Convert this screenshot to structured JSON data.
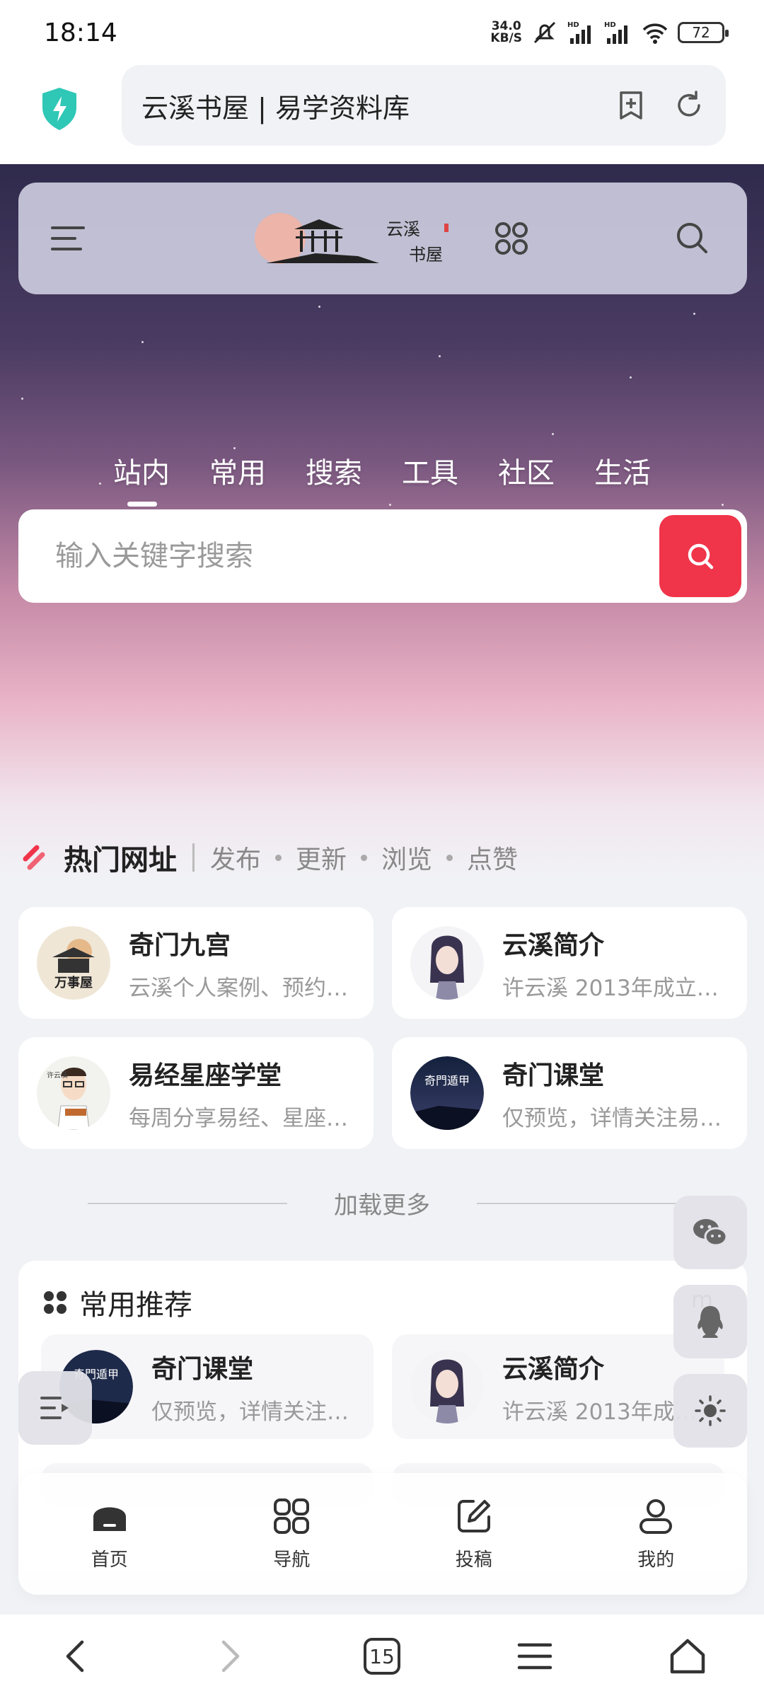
{
  "status_bar": {
    "time": "18:14",
    "net_speed_value": "34.0",
    "net_speed_unit": "KB/S",
    "battery": "72",
    "icons": [
      "mute-icon",
      "signal-hd-icon",
      "signal-hd-icon",
      "wifi-icon",
      "battery-icon"
    ]
  },
  "browser": {
    "url_title": "云溪书屋 | 易学资料库",
    "icons": [
      "shield-bolt-icon",
      "bookmark-add-icon",
      "refresh-icon"
    ]
  },
  "site_header": {
    "logo_text_1": "云溪",
    "logo_text_2": "书屋",
    "icons": [
      "menu-icon",
      "apps-icon",
      "search-icon"
    ]
  },
  "search_tabs": [
    "站内",
    "常用",
    "搜索",
    "工具",
    "社区",
    "生活"
  ],
  "search": {
    "placeholder": "输入关键字搜索"
  },
  "hot": {
    "title": "热门网址",
    "filters": [
      "发布",
      "更新",
      "浏览",
      "点赞"
    ],
    "cards": [
      {
        "title": "奇门九宫",
        "desc": "云溪个人案例、预约…",
        "avatar_text": "万事屋"
      },
      {
        "title": "云溪简介",
        "desc": "许云溪 2013年成立…",
        "avatar_text": ""
      },
      {
        "title": "易经星座学堂",
        "desc": "每周分享易经、星座…",
        "avatar_text": "许云溪"
      },
      {
        "title": "奇门课堂",
        "desc": "仅预览，详情关注易…",
        "avatar_text": "奇門遁甲"
      }
    ],
    "load_more": "加载更多"
  },
  "recommend": {
    "title": "常用推荐",
    "more": "m",
    "cards": [
      {
        "title": "奇门课堂",
        "desc": "仅预览，详情关注…"
      },
      {
        "title": "云溪简介",
        "desc": "许云溪 2013年成…"
      }
    ]
  },
  "floating": [
    "wechat-icon",
    "qq-icon",
    "brightness-icon",
    "list-toggle-icon"
  ],
  "app_nav": [
    {
      "label": "首页",
      "icon": "home-icon"
    },
    {
      "label": "导航",
      "icon": "grid-icon"
    },
    {
      "label": "投稿",
      "icon": "edit-icon"
    },
    {
      "label": "我的",
      "icon": "user-icon"
    }
  ],
  "system_nav": {
    "tab_count": "15",
    "icons": [
      "back-icon",
      "forward-icon",
      "tabs-icon",
      "menu-icon",
      "home-icon"
    ]
  },
  "colors": {
    "accent_red": "#f0344a",
    "shield_teal": "#2fc7b6"
  }
}
